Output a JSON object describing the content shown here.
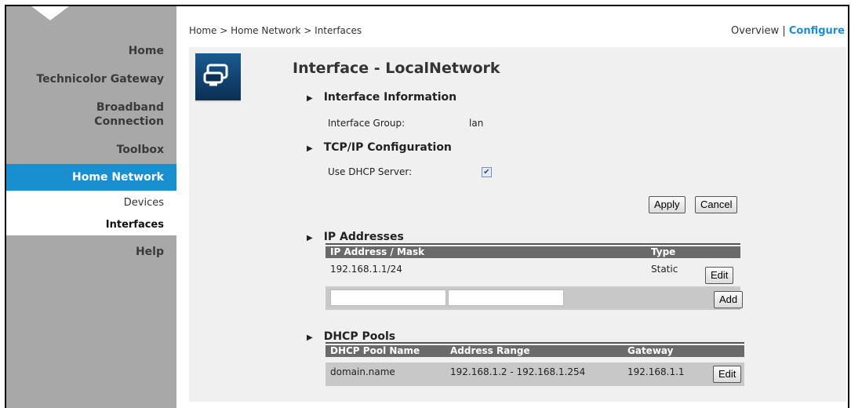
{
  "breadcrumb": "Home > Home Network > Interfaces",
  "topright": {
    "overview": "Overview",
    "separator": " | ",
    "configure": "Configure"
  },
  "sidebar": {
    "items": [
      {
        "label": "Home"
      },
      {
        "label": "Technicolor Gateway"
      },
      {
        "label": "Broadband\nConnection"
      },
      {
        "label": "Toolbox"
      },
      {
        "label": "Home Network"
      },
      {
        "label": "Help"
      }
    ],
    "subitems": [
      {
        "label": "Devices"
      },
      {
        "label": "Interfaces"
      }
    ]
  },
  "page": {
    "title": "Interface - LocalNetwork",
    "sections": {
      "info": "Interface Information",
      "tcpip": "TCP/IP Configuration",
      "ip": "IP Addresses",
      "dhcp": "DHCP Pools"
    },
    "interface_group_label": "Interface Group:",
    "interface_group_value": "lan",
    "dhcp_server_label": "Use DHCP Server:",
    "dhcp_server_checked": true,
    "apply_label": "Apply",
    "cancel_label": "Cancel",
    "ip_table": {
      "headers": [
        "IP Address / Mask",
        "Type"
      ],
      "rows": [
        {
          "address": "192.168.1.1/24",
          "type": "Static",
          "edit": "Edit"
        }
      ],
      "add_label": "Add"
    },
    "dhcp_table": {
      "headers": [
        "DHCP Pool Name",
        "Address Range",
        "Gateway"
      ],
      "rows": [
        {
          "name": "domain.name",
          "range": "192.168.1.2 - 192.168.1.254",
          "gateway": "192.168.1.1",
          "edit": "Edit"
        }
      ]
    }
  },
  "colors": {
    "accent": "#1a8fd0",
    "sidebar": "#a8a8a8",
    "table_header": "#6a6a6a"
  }
}
